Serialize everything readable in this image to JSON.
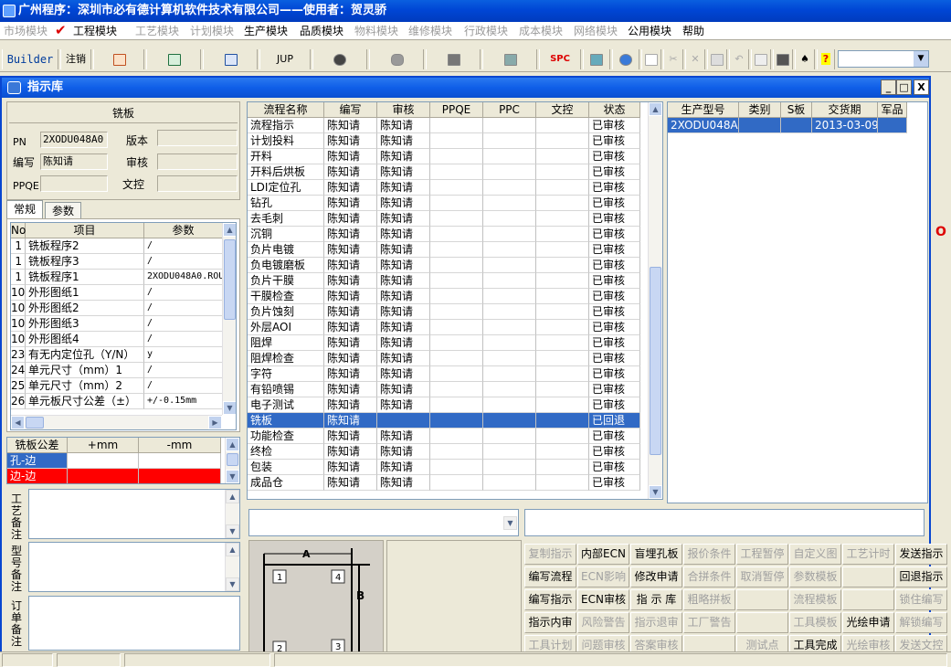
{
  "app_title": "广州程序：深圳市必有德计算机软件技术有限公司——使用者：贺灵骄",
  "menus": [
    {
      "label": "市场模块",
      "dim": true
    },
    {
      "label": "工程模块",
      "dim": false
    },
    {
      "label": "工艺模块",
      "dim": true
    },
    {
      "label": "计划模块",
      "dim": true
    },
    {
      "label": "生产模块",
      "dim": false
    },
    {
      "label": "品质模块",
      "dim": false
    },
    {
      "label": "物料模块",
      "dim": true
    },
    {
      "label": "维修模块",
      "dim": true
    },
    {
      "label": "行政模块",
      "dim": true
    },
    {
      "label": "成本模块",
      "dim": true
    },
    {
      "label": "网络模块",
      "dim": true
    },
    {
      "label": "公用模块",
      "dim": false
    },
    {
      "label": "帮助",
      "dim": false
    }
  ],
  "toolbar": {
    "builder": "Builder",
    "logout": "注销",
    "jup": "JUP",
    "spc": "SPC"
  },
  "window": {
    "title": "指示库",
    "minimize": "_",
    "restore": "□",
    "close": "X"
  },
  "form": {
    "section_title": "铣板",
    "pn_label": "PN",
    "pn_value": "2XODU048A0",
    "version_label": "版本",
    "version_value": "",
    "author_label": "编写",
    "author_value": "陈知请",
    "review_label": "审核",
    "review_value": "",
    "ppqe_label": "PPQE",
    "ppqe_value": "",
    "doc_label": "文控",
    "doc_value": ""
  },
  "tabs": [
    {
      "label": "常规"
    },
    {
      "label": "参数"
    }
  ],
  "params_table": {
    "headers": [
      "No",
      "项目",
      "参数"
    ],
    "rows": [
      [
        "1",
        "铣板程序2",
        "/"
      ],
      [
        "1",
        "铣板程序3",
        "/"
      ],
      [
        "1",
        "铣板程序1",
        "2XODU048A0.ROU"
      ],
      [
        "10",
        "外形图纸1",
        "/"
      ],
      [
        "10",
        "外形图纸2",
        "/"
      ],
      [
        "10",
        "外形图纸3",
        "/"
      ],
      [
        "10",
        "外形图纸4",
        "/"
      ],
      [
        "23",
        "有无内定位孔（Y/N）",
        "y"
      ],
      [
        "24",
        "单元尺寸（mm）1",
        "/"
      ],
      [
        "25",
        "单元尺寸（mm）2",
        "/"
      ],
      [
        "26",
        "单元板尺寸公差（±）",
        "+/-0.15mm"
      ]
    ]
  },
  "tolerance_table": {
    "headers": [
      "铣板公差",
      "+mm",
      "-mm"
    ],
    "rows": [
      [
        "孔-边",
        "",
        ""
      ],
      [
        "边-边",
        "",
        ""
      ]
    ]
  },
  "remarks": [
    {
      "label": "工艺备注"
    },
    {
      "label": "型号备注"
    },
    {
      "label": "订单备注"
    }
  ],
  "flow_table": {
    "headers": [
      "流程名称",
      "编写",
      "审核",
      "PPQE",
      "PPC",
      "文控",
      "状态"
    ],
    "rows": [
      [
        "流程指示",
        "陈知请",
        "陈知请",
        "",
        "",
        "",
        "已审核"
      ],
      [
        "计划投料",
        "陈知请",
        "陈知请",
        "",
        "",
        "",
        "已审核"
      ],
      [
        "开料",
        "陈知请",
        "陈知请",
        "",
        "",
        "",
        "已审核"
      ],
      [
        "开料后烘板",
        "陈知请",
        "陈知请",
        "",
        "",
        "",
        "已审核"
      ],
      [
        "LDI定位孔",
        "陈知请",
        "陈知请",
        "",
        "",
        "",
        "已审核"
      ],
      [
        "钻孔",
        "陈知请",
        "陈知请",
        "",
        "",
        "",
        "已审核"
      ],
      [
        "去毛刺",
        "陈知请",
        "陈知请",
        "",
        "",
        "",
        "已审核"
      ],
      [
        "沉铜",
        "陈知请",
        "陈知请",
        "",
        "",
        "",
        "已审核"
      ],
      [
        "负片电镀",
        "陈知请",
        "陈知请",
        "",
        "",
        "",
        "已审核"
      ],
      [
        "负电镀磨板",
        "陈知请",
        "陈知请",
        "",
        "",
        "",
        "已审核"
      ],
      [
        "负片干膜",
        "陈知请",
        "陈知请",
        "",
        "",
        "",
        "已审核"
      ],
      [
        "干膜检查",
        "陈知请",
        "陈知请",
        "",
        "",
        "",
        "已审核"
      ],
      [
        "负片蚀刻",
        "陈知请",
        "陈知请",
        "",
        "",
        "",
        "已审核"
      ],
      [
        "外层AOI",
        "陈知请",
        "陈知请",
        "",
        "",
        "",
        "已审核"
      ],
      [
        "阻焊",
        "陈知请",
        "陈知请",
        "",
        "",
        "",
        "已审核"
      ],
      [
        "阻焊检查",
        "陈知请",
        "陈知请",
        "",
        "",
        "",
        "已审核"
      ],
      [
        "字符",
        "陈知请",
        "陈知请",
        "",
        "",
        "",
        "已审核"
      ],
      [
        "有铅喷锡",
        "陈知请",
        "陈知请",
        "",
        "",
        "",
        "已审核"
      ],
      [
        "电子测试",
        "陈知请",
        "陈知请",
        "",
        "",
        "",
        "已审核"
      ],
      [
        "铣板",
        "陈知请",
        "",
        "",
        "",
        "",
        "已回退"
      ],
      [
        "功能检查",
        "陈知请",
        "陈知请",
        "",
        "",
        "",
        "已审核"
      ],
      [
        "终检",
        "陈知请",
        "陈知请",
        "",
        "",
        "",
        "已审核"
      ],
      [
        "包装",
        "陈知请",
        "陈知请",
        "",
        "",
        "",
        "已审核"
      ],
      [
        "成品仓",
        "陈知请",
        "陈知请",
        "",
        "",
        "",
        "已审核"
      ]
    ],
    "selected_row": 19
  },
  "model_table": {
    "headers": [
      "生产型号",
      "类别",
      "S板",
      "交货期",
      "军品"
    ],
    "rows": [
      [
        "2XODU048A0",
        "",
        "",
        "2013-03-09",
        ""
      ]
    ]
  },
  "drawing": {
    "label_a": "A",
    "label_b": "B",
    "n1": "1",
    "n2": "2",
    "n3": "3",
    "n4": "4"
  },
  "buttons": [
    [
      {
        "label": "复制指示",
        "dim": true
      },
      {
        "label": "内部ECN",
        "dim": false
      },
      {
        "label": "盲埋孔板",
        "dim": false
      },
      {
        "label": "报价条件",
        "dim": true
      },
      {
        "label": "工程暂停",
        "dim": true
      },
      {
        "label": "自定义图",
        "dim": true
      },
      {
        "label": "工艺计时",
        "dim": true
      },
      {
        "label": "发送指示",
        "dim": false
      }
    ],
    [
      {
        "label": "编写流程",
        "dim": false
      },
      {
        "label": "ECN影响",
        "dim": true
      },
      {
        "label": "修改申请",
        "dim": false
      },
      {
        "label": "合拼条件",
        "dim": true
      },
      {
        "label": "取消暂停",
        "dim": true
      },
      {
        "label": "参数模板",
        "dim": true
      },
      {
        "label": "",
        "dim": true
      },
      {
        "label": "回退指示",
        "dim": false
      }
    ],
    [
      {
        "label": "编写指示",
        "dim": false
      },
      {
        "label": "ECN审核",
        "dim": false
      },
      {
        "label": "指 示 库",
        "dim": false
      },
      {
        "label": "粗略拼板",
        "dim": true
      },
      {
        "label": "",
        "dim": true
      },
      {
        "label": "流程模板",
        "dim": true
      },
      {
        "label": "",
        "dim": true
      },
      {
        "label": "锁住编写",
        "dim": true
      }
    ],
    [
      {
        "label": "指示内审",
        "dim": false
      },
      {
        "label": "风险警告",
        "dim": true
      },
      {
        "label": "指示退审",
        "dim": true
      },
      {
        "label": "工厂警告",
        "dim": true
      },
      {
        "label": "",
        "dim": true
      },
      {
        "label": "工具模板",
        "dim": true
      },
      {
        "label": "光绘申请",
        "dim": false
      },
      {
        "label": "解锁编写",
        "dim": true
      }
    ],
    [
      {
        "label": "工具计划",
        "dim": true
      },
      {
        "label": "问题审核",
        "dim": true
      },
      {
        "label": "答案审核",
        "dim": true
      },
      {
        "label": "",
        "dim": true
      },
      {
        "label": "测试点",
        "dim": true
      },
      {
        "label": "工具完成",
        "dim": false
      },
      {
        "label": "光绘审核",
        "dim": true
      },
      {
        "label": "发送文控",
        "dim": true
      }
    ]
  ],
  "edge_glyph": "O",
  "colors": {
    "title_blue": "#0054e3",
    "selection": "#316ac5",
    "red_row": "#ff0000"
  }
}
